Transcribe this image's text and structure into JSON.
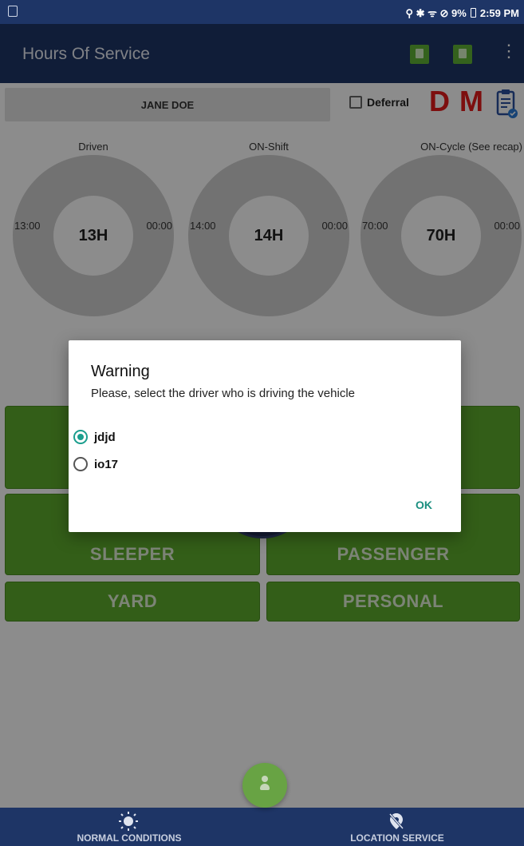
{
  "status_bar": {
    "indicators": "⚲ ✱ ᯤ ⊘ 9%",
    "time": "2:59 PM"
  },
  "app": {
    "title": "Hours Of Service"
  },
  "driver": {
    "name": "JANE DOE",
    "deferral_label": "Deferral",
    "d_badge": "D",
    "m_badge": "M"
  },
  "gauges": [
    {
      "label": "Driven",
      "center": "13H",
      "left": "13:00",
      "right": "00:00"
    },
    {
      "label": "ON-Shift",
      "center": "14H",
      "left": "14:00",
      "right": "00:00"
    },
    {
      "label": "ON-Cycle (See recap)",
      "center": "70H",
      "left": "70:00",
      "right": "00:00"
    }
  ],
  "duty_buttons": {
    "sleeper": "SLEEPER",
    "passenger": "PASSENGER",
    "yard": "YARD",
    "personal": "PERSONAL"
  },
  "dialog": {
    "title": "Warning",
    "message": "Please, select the driver who is driving the vehicle",
    "options": [
      {
        "label": "jdjd",
        "selected": true
      },
      {
        "label": "io17",
        "selected": false
      }
    ],
    "ok_label": "OK"
  },
  "bottom_nav": {
    "left": "NORMAL CONDITIONS",
    "right": "LOCATION SERVICE"
  },
  "colors": {
    "navy": "#1e3566",
    "green": "#5dab2c",
    "red": "#e41b1b",
    "teal": "#1b9e8e"
  }
}
